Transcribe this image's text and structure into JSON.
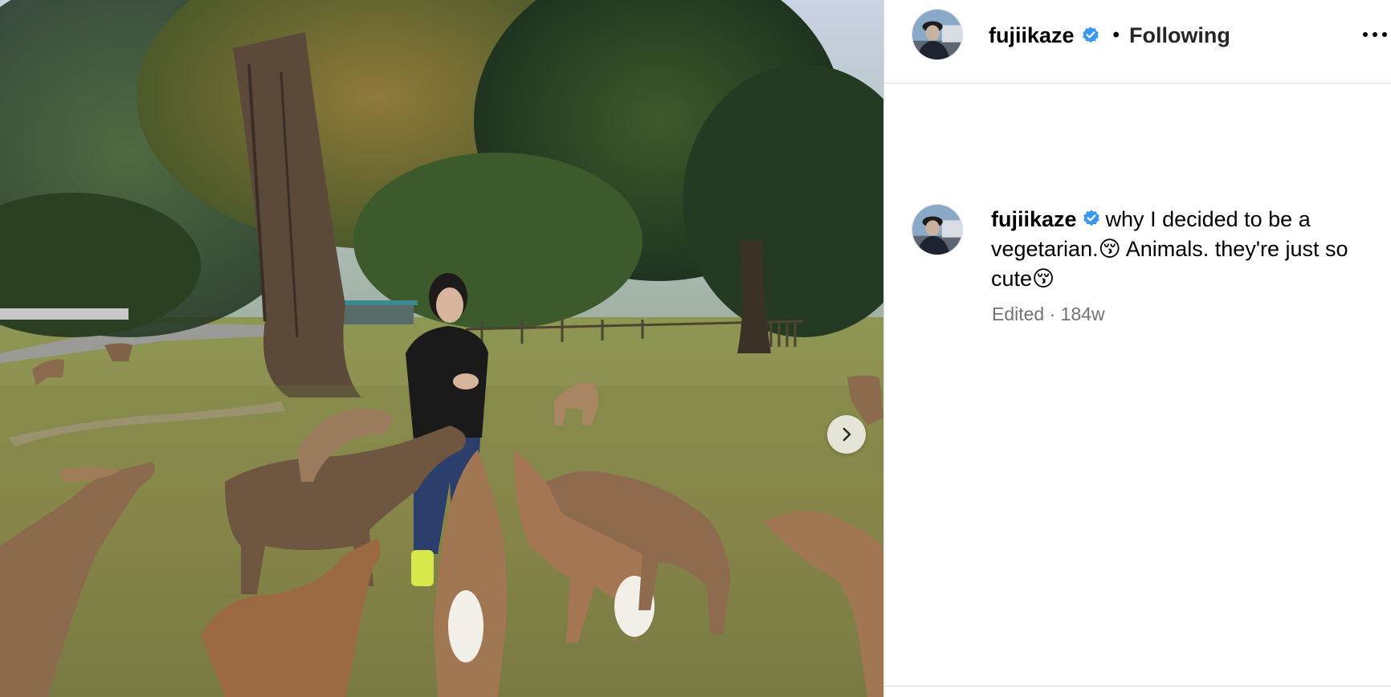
{
  "post": {
    "author": {
      "username": "fujiikaze",
      "verified": true
    },
    "separator": "•",
    "follow_state": "Following",
    "caption": {
      "text_part1": "why I decided to be a vegetarian.",
      "emoji1": "😚",
      "text_part2": " Animals. they're just so cute",
      "emoji2": "😚"
    },
    "meta": {
      "edited": "Edited",
      "dot": " · ",
      "age": "184w"
    }
  },
  "icons": {
    "verified": "verified-badge-icon",
    "more": "more-options-icon",
    "next": "chevron-right-icon"
  },
  "colors": {
    "verified_blue": "#3897f0",
    "meta_gray": "#737373",
    "divider": "#dbdbdb"
  }
}
